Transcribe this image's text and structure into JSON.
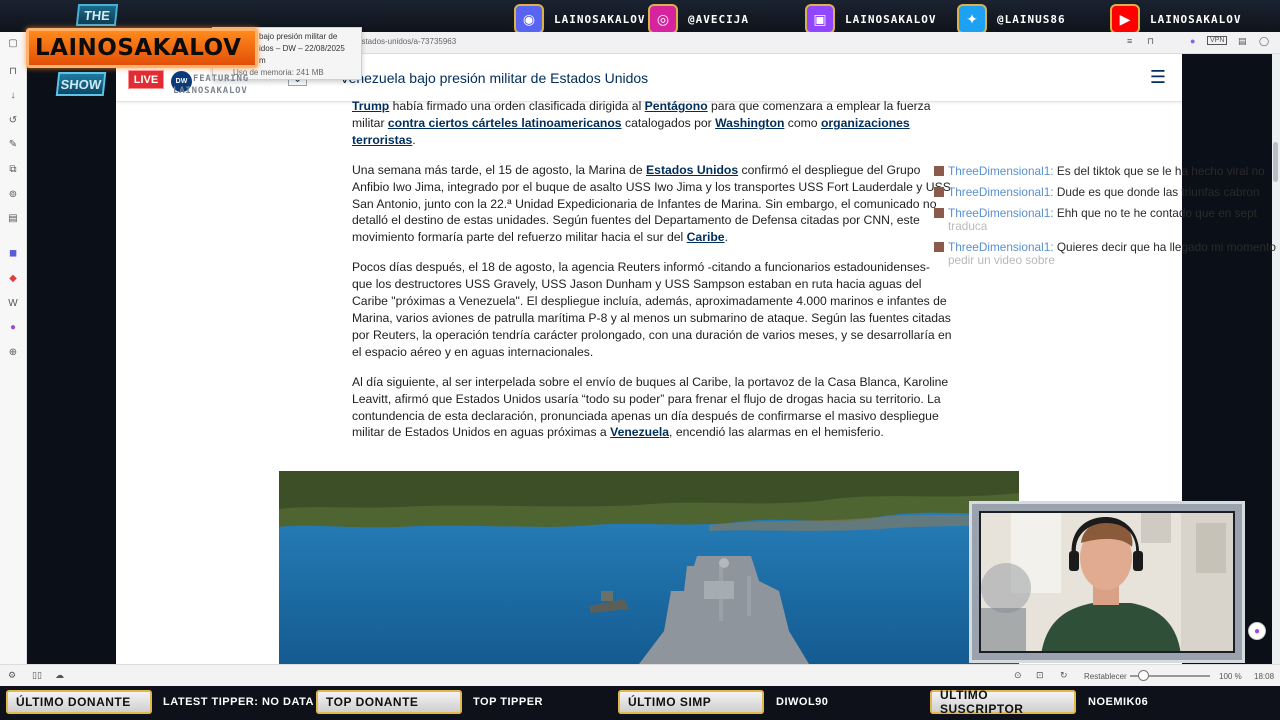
{
  "stream": {
    "logo": {
      "the": "THE",
      "name": "LAINOSAKALOV",
      "show": "SHOW",
      "live": "LIVE",
      "featuring": [
        "FEATURING",
        "LAINOSAKALOV"
      ]
    },
    "socials": [
      {
        "icon": "discord-icon",
        "label": "LAINOSAKALOV",
        "color": "#5865f2"
      },
      {
        "icon": "instagram-icon",
        "label": "@AVECIJA",
        "color": "#d6249f"
      },
      {
        "icon": "twitch-icon",
        "label": "LAINOSAKALOV",
        "color": "#9146ff"
      },
      {
        "icon": "twitter-icon",
        "label": "@LAINUS86",
        "color": "#1da1f2"
      },
      {
        "icon": "youtube-icon",
        "label": "LAINOSAKALOV",
        "color": "#ff0000"
      }
    ],
    "ticker": {
      "ultimo_donante_label": "ÚLTIMO DONANTE",
      "latest_tipper": "LATEST TIPPER: NO DATA",
      "top_donante_label": "TOP DONANTE",
      "top_tipper": "TOP TIPPER",
      "ultimo_simp_label": "ÚLTIMO SIMP",
      "ultimo_simp_value": "DIWOL90",
      "ultimo_suscriptor_label": "ÚLTIMO SUSCRIPTOR",
      "ultimo_suscriptor_value": "NOEMIK06"
    }
  },
  "browser": {
    "tab_tooltip": {
      "title_line1": "bajo presión militar de",
      "title_line2": "idos – DW – 22/08/2025",
      "extra": "m",
      "memory": "Uso de memoria: 241 MB"
    },
    "url": "estados-unidos/a-73735963",
    "status": {
      "restablecer": "Restablecer",
      "zoom": "100 %",
      "time": "18:08",
      "zoom_level": 0.16
    }
  },
  "page": {
    "header_title": "Venezuela bajo presión militar de Estados Unidos",
    "paragraphs": [
      [
        {
          "t": "Trump",
          "link": true
        },
        {
          "t": " había firmado una orden clasificada dirigida al "
        },
        {
          "t": "Pentágono",
          "link": true
        },
        {
          "t": " para que comenzara a emplear la fuerza militar "
        },
        {
          "t": "contra ciertos cárteles latinoamericanos",
          "link": true
        },
        {
          "t": " catalogados por "
        },
        {
          "t": "Washington",
          "link": true
        },
        {
          "t": " como "
        },
        {
          "t": "organizaciones terroristas",
          "link": true
        },
        {
          "t": "."
        }
      ],
      [
        {
          "t": "Una semana más tarde, el 15 de agosto, la Marina de "
        },
        {
          "t": "Estados Unidos",
          "link": true
        },
        {
          "t": " confirmó el despliegue del Grupo Anfibio Iwo Jima, integrado por el buque de asalto USS Iwo Jima y los transportes USS Fort Lauderdale y USS San Antonio, junto con la 22.ª Unidad Expedicionaria de Infantes de Marina. Sin embargo, el comunicado no detalló el destino de estas unidades. Según fuentes del Departamento de Defensa citadas por CNN, este movimiento formaría parte del refuerzo militar hacia el sur del "
        },
        {
          "t": "Caribe",
          "link": true
        },
        {
          "t": "."
        }
      ],
      [
        {
          "t": "Pocos días después, el 18 de agosto, la agencia Reuters informó -citando a funcionarios estadounidenses- que los destructores USS Gravely, USS Jason Dunham y USS Sampson estaban en ruta hacia aguas del Caribe \"próximas a Venezuela\". El despliegue incluía, además, aproximadamente 4.000 marinos e infantes de Marina, varios aviones de patrulla marítima P-8 y al menos un submarino de ataque. Según las fuentes citadas por Reuters, la operación tendría carácter prolongado, con una duración de varios meses, y se desarrollaría en el espacio aéreo y en aguas internacionales."
        }
      ],
      [
        {
          "t": "Al día siguiente, al ser interpelada sobre el envío de buques al Caribe, la portavoz de la Casa Blanca, Karoline Leavitt, afirmó que Estados Unidos usaría “todo su poder” para frenar el flujo de drogas hacia su territorio. La contundencia de esta declaración, pronunciada apenas un día después de confirmarse el masivo despliegue militar de Estados Unidos en aguas próximas a "
        },
        {
          "t": "Venezuela",
          "link": true
        },
        {
          "t": ", encendió las alarmas en el hemisferio."
        }
      ]
    ]
  },
  "chat": [
    {
      "user": "ThreeDimensional1:",
      "text": "Es del tiktok que se le ha hecho viral no"
    },
    {
      "user": "ThreeDimensional1:",
      "text": "Dude es que donde las triunfas cabron"
    },
    {
      "user": "ThreeDimensional1:",
      "text": "Ehh que no te he contado que en sept",
      "cont": "traduca"
    },
    {
      "user": "ThreeDimensional1:",
      "text": "Quieres decir que ha llegado mi momento",
      "cont": "pedir un video sobre"
    }
  ]
}
